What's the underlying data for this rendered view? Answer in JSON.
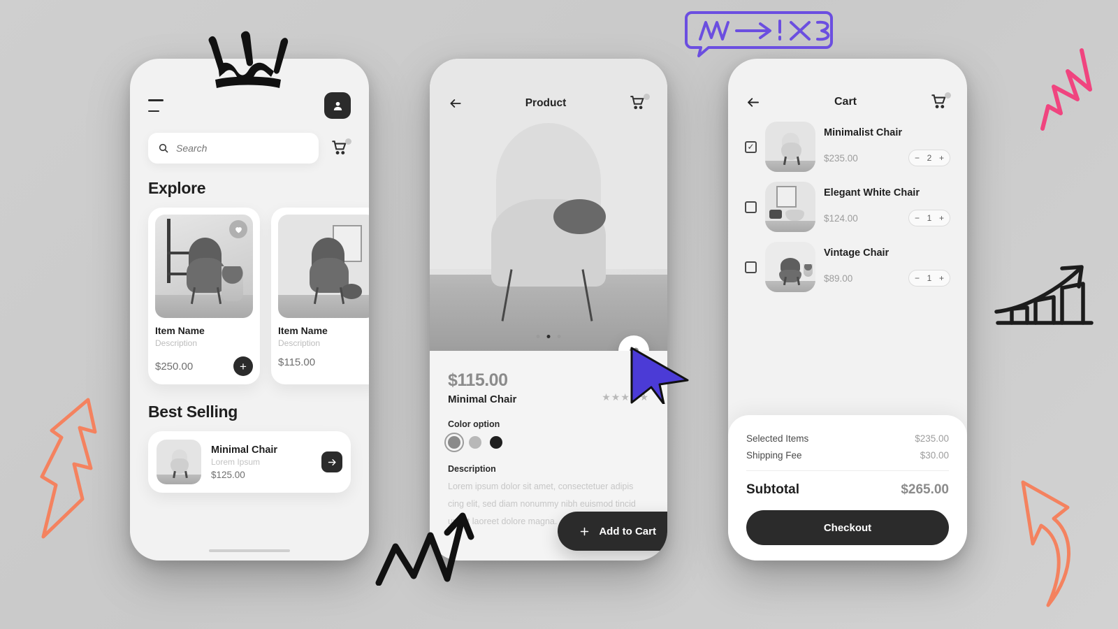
{
  "canvas": {
    "background_color": "#cccccc",
    "accent_dark": "#2b2b2b",
    "cursor_color": "#4b3bd6",
    "doodle_pink": "#f04a86",
    "doodle_orange": "#f5815f",
    "doodle_purple": "#6b4ee0"
  },
  "home": {
    "icons": {
      "menu": "hamburger-menu-icon",
      "profile": "user-avatar-icon",
      "search": "search-icon",
      "cart": "shopping-cart-icon",
      "heart": "heart-icon",
      "plus": "plus-icon",
      "arrow": "arrow-right-icon"
    },
    "search": {
      "placeholder": "Search",
      "value": ""
    },
    "explore_title": "Explore",
    "explore_items": [
      {
        "name": "Item Name",
        "description": "Description",
        "price": "$250.00",
        "favorited": true,
        "scene": "sc1"
      },
      {
        "name": "Item Name",
        "description": "Description",
        "price": "$115.00",
        "favorited": false,
        "scene": "sc2"
      }
    ],
    "best_selling_title": "Best Selling",
    "best_selling": {
      "name": "Minimal Chair",
      "subtitle": "Lorem Ipsum",
      "price": "$125.00"
    }
  },
  "detail": {
    "title": "Product",
    "icons": {
      "back": "arrow-left-icon",
      "cart": "shopping-cart-icon",
      "favorite": "heart-icon",
      "plus": "plus-icon"
    },
    "carousel_dots": 3,
    "carousel_active_index": 1,
    "price": "$115.00",
    "name": "Minimal Chair",
    "rating_stars": "★★★★★",
    "rating_value": 4.5,
    "color_option_label": "Color option",
    "colors": [
      {
        "hex": "#8a8a8a",
        "selected": true
      },
      {
        "hex": "#b8b8b8",
        "selected": false
      },
      {
        "hex": "#1f1f1f",
        "selected": false
      }
    ],
    "description_label": "Description",
    "description_text": "Lorem ipsum dolor sit amet, consectetuer adipis cing elit, sed diam nonummy nibh euismod tincid unt ut laoreet dolore magna.",
    "add_to_cart_label": "Add to Cart"
  },
  "cart": {
    "title": "Cart",
    "icons": {
      "back": "arrow-left-icon",
      "cart": "shopping-cart-icon",
      "check": "checkbox-icon"
    },
    "items": [
      {
        "name": "Minimalist Chair",
        "price": "$235.00",
        "qty": "2",
        "checked": true,
        "scene": "sc3"
      },
      {
        "name": "Elegant White Chair",
        "price": "$124.00",
        "qty": "1",
        "checked": false,
        "scene": "sc2"
      },
      {
        "name": "Vintage Chair",
        "price": "$89.00",
        "qty": "1",
        "checked": false,
        "scene": "sc4"
      }
    ],
    "stepper": {
      "minus": "−",
      "plus": "+"
    },
    "summary": {
      "selected_items_label": "Selected Items",
      "selected_items_value": "$235.00",
      "shipping_label": "Shipping Fee",
      "shipping_value": "$30.00",
      "subtotal_label": "Subtotal",
      "subtotal_value": "$265.00"
    },
    "checkout_label": "Checkout"
  },
  "doodles": [
    {
      "name": "crown-doodle",
      "style": "black-brush"
    },
    {
      "name": "speech-bubble-doodle",
      "style": "purple-outline",
      "content": "scribble-arrow-scribble"
    },
    {
      "name": "pink-zigzag-doodle",
      "style": "pink-line"
    },
    {
      "name": "growth-chart-doodle",
      "style": "black-marker"
    },
    {
      "name": "lightning-bolt-doodle",
      "style": "orange-outline"
    },
    {
      "name": "curved-arrow-doodle",
      "style": "orange-outline"
    },
    {
      "name": "zigzag-arrow-doodle",
      "style": "black-marker"
    }
  ]
}
